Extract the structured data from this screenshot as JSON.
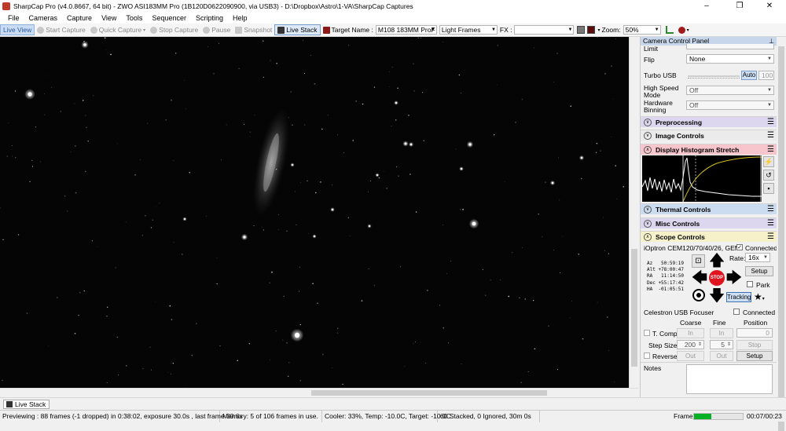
{
  "window": {
    "title": "SharpCap Pro (v4.0.8667, 64 bit) - ZWO ASI183MM Pro (1B120D0622090900, via USB3) - D:\\Dropbox\\Astro\\1-VA\\SharpCap Captures",
    "minimize": "–",
    "maximize": "❐",
    "close": "✕"
  },
  "menu": [
    "File",
    "Cameras",
    "Capture",
    "View",
    "Tools",
    "Sequencer",
    "Scripting",
    "Help"
  ],
  "toolbar": {
    "live_view": "Live View",
    "start_capture": "Start Capture",
    "quick_capture": "Quick Capture",
    "stop_capture": "Stop Capture",
    "pause": "Pause",
    "snapshot": "Snapshot",
    "live_stack": "Live Stack",
    "target_label": "Target Name :",
    "target_value": "M108 183MM ProF",
    "frame_type": "Light Frames",
    "fx_label": "FX :",
    "zoom_label": "Zoom:",
    "zoom_value": "50%"
  },
  "panel": {
    "header": "Camera Control Panel",
    "limit_label": "Limit",
    "flip_label": "Flip",
    "flip_value": "None",
    "turbo_label": "Turbo USB",
    "turbo_auto": "Auto",
    "turbo_value": "100",
    "high_speed_label": "High Speed Mode",
    "high_speed_value": "Off",
    "hw_binning_label": "Hardware Binning",
    "hw_binning_value": "Off",
    "sections": {
      "preprocessing": "Preprocessing",
      "image_controls": "Image Controls",
      "histogram": "Display Histogram Stretch",
      "thermal": "Thermal Controls",
      "misc": "Misc Controls",
      "scope": "Scope Controls"
    },
    "mount_name": "iOptron CEM120/70/40/26, GEM45/",
    "connected_label": "Connected",
    "coords": "Az   50:59:19\nAlt +78:00:47\nRA   11:14:50\nDec +55:17:42\nHA  -01:05:51",
    "rate_label": "Rate:",
    "rate_value": "16x",
    "setup_label": "Setup",
    "park_label": "Park",
    "stop_label": "STOP",
    "tracking_label": "Tracking",
    "focuser_name": "Celestron USB Focuser",
    "focuser_connected": "Connected",
    "coarse_label": "Coarse",
    "fine_label": "Fine",
    "position_label": "Position",
    "tcomp_label": "T. Comp",
    "in_label": "In",
    "out_label": "Out",
    "position_value": "0",
    "stepsize_label": "Step Size",
    "coarse_step": "200",
    "fine_step": "5",
    "reverse_label": "Reverse",
    "stop_btn": "Stop",
    "notes_label": "Notes"
  },
  "tab": {
    "live_stack": "Live Stack"
  },
  "status": {
    "preview": "Previewing : 88 frames (-1 dropped) in 0:38:02, exposure 30.0s , last frame 30.6s",
    "memory": "Memory: 5 of 106 frames in use.",
    "cooler": "Cooler: 33%, Temp: -10.0C, Target: -10.0C",
    "stacked": "60 Stacked, 0 Ignored, 30m 0s",
    "frame_label": "Frame:",
    "elapsed": "00:07/00:23",
    "frame_progress": 0.35
  },
  "colors": {
    "accent": "#2b5aa0",
    "stop": "#e0141e",
    "progress": "#06b025",
    "histogram_curve": "#d6c11a"
  }
}
